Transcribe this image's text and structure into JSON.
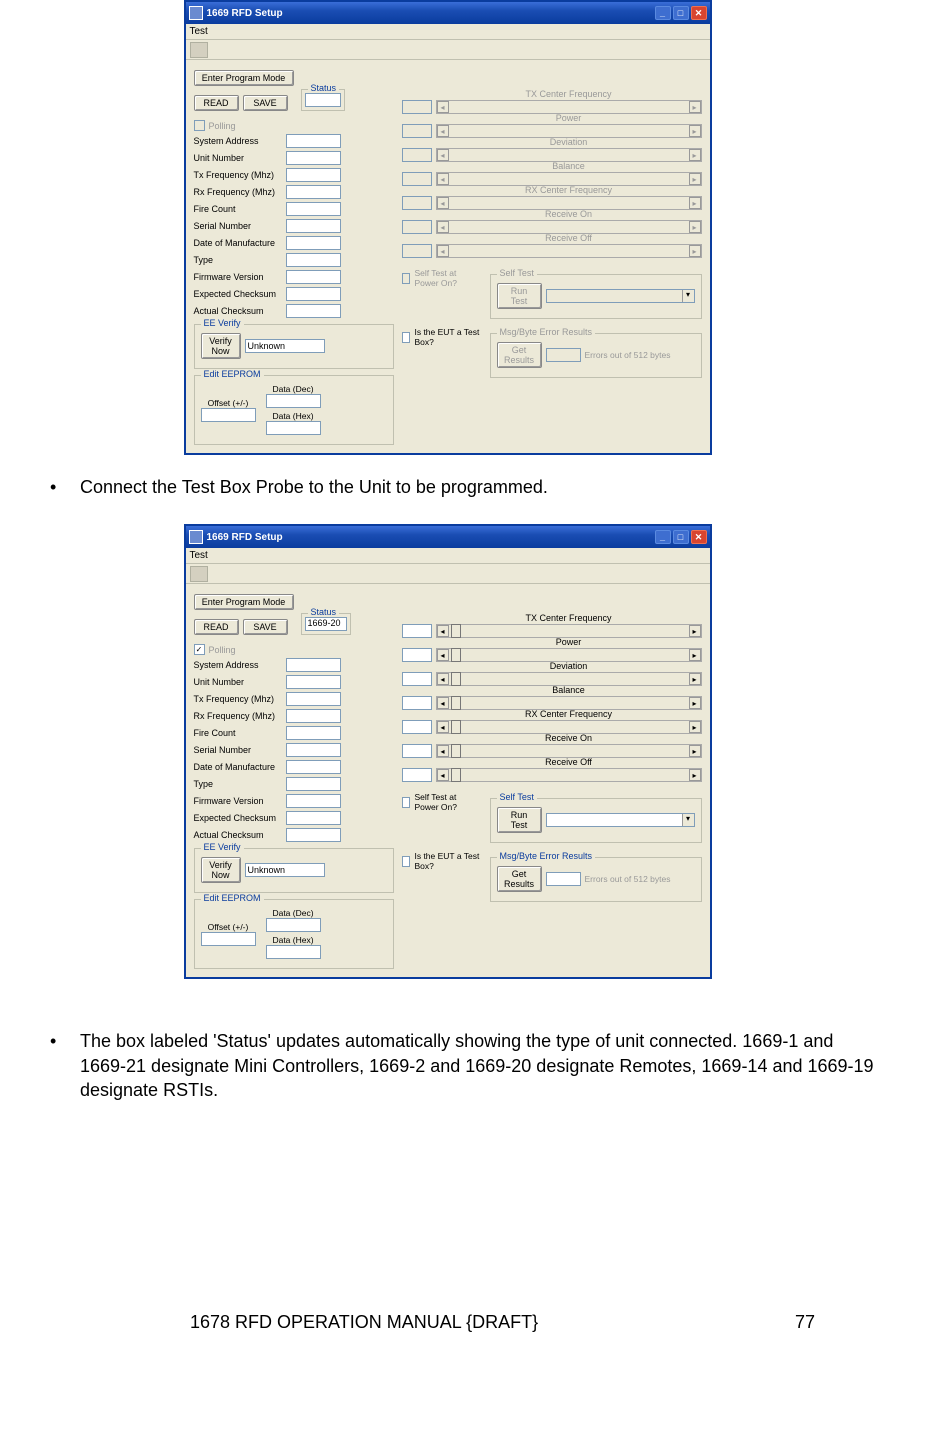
{
  "bullets": {
    "b1": "Connect the Test Box Probe to the Unit to be programmed.",
    "b2": "The box labeled 'Status' updates automatically showing the type of unit connected.  1669-1 and 1669-21 designate Mini Controllers, 1669-2 and 1669-20 designate Remotes, 1669-14 and 1669-19 designate RSTIs."
  },
  "footer": {
    "title": "1678 RFD OPERATION MANUAL {DRAFT}",
    "page": "77"
  },
  "window": {
    "title": "1669 RFD Setup",
    "menu": {
      "test": "Test"
    },
    "buttons": {
      "enter_program_mode": "Enter Program Mode",
      "read": "READ",
      "save": "SAVE",
      "verify_now": "Verify Now",
      "run_test": "Run Test",
      "get_results": "Get Results"
    },
    "labels": {
      "status": "Status",
      "polling": "Polling",
      "system_address": "System Address",
      "unit_number": "Unit Number",
      "tx_frequency": "Tx Frequency (Mhz)",
      "rx_frequency": "Rx Frequency (Mhz)",
      "fire_count": "Fire Count",
      "serial_number": "Serial Number",
      "date_of_manufacture": "Date of Manufacture",
      "type": "Type",
      "firmware_version": "Firmware Version",
      "expected_checksum": "Expected Checksum",
      "actual_checksum": "Actual Checksum",
      "ee_verify": "EE Verify",
      "unknown": "Unknown",
      "edit_eeprom": "Edit EEPROM",
      "offset": "Offset (+/-)",
      "data_dec": "Data (Dec)",
      "data_hex": "Data (Hex)",
      "self_test_at_power_on": "Self Test at Power On?",
      "is_eut_test_box": "Is the EUT a Test Box?",
      "self_test": "Self Test",
      "msg_byte_error_results": "Msg/Byte Error Results",
      "errors_out_of": "Errors out of 512 bytes"
    },
    "sliders": {
      "tx_center_frequency": "TX Center Frequency",
      "power": "Power",
      "deviation": "Deviation",
      "balance": "Balance",
      "rx_center_frequency": "RX Center Frequency",
      "receive_on": "Receive On",
      "receive_off": "Receive Off"
    },
    "status_values": {
      "empty": "",
      "connected": "1669-20"
    }
  }
}
